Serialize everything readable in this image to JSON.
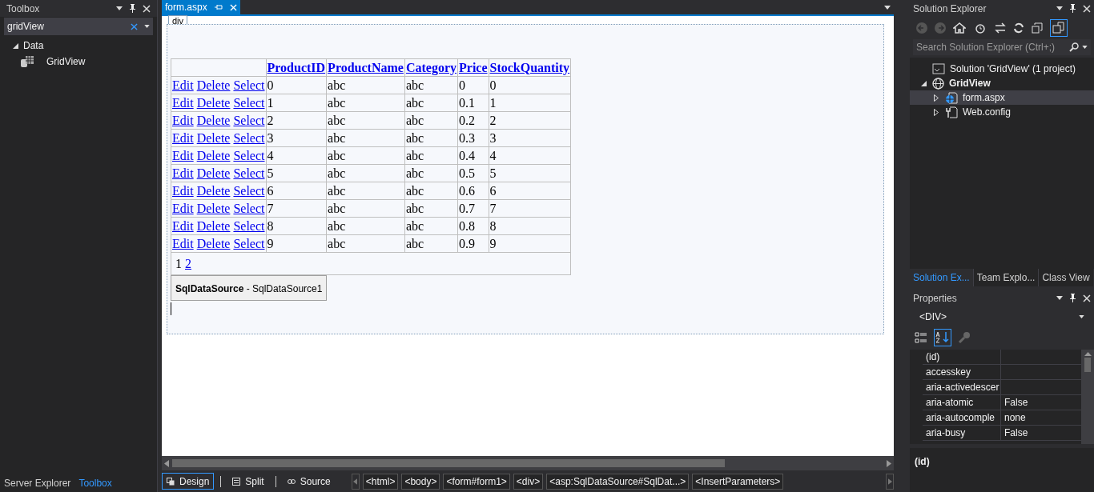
{
  "toolbox": {
    "title": "Toolbox",
    "search": "gridView",
    "groups": [
      {
        "label": "Data",
        "expanded": true,
        "children": [
          {
            "label": "GridView"
          }
        ]
      }
    ],
    "bottom_tabs": [
      {
        "label": "Server Explorer",
        "selected": false
      },
      {
        "label": "Toolbox",
        "selected": true
      }
    ]
  },
  "editor": {
    "tab": "form.aspx",
    "tag_label": "div",
    "grid": {
      "columns": [
        "ProductID",
        "ProductName",
        "Category",
        "Price",
        "StockQuantity"
      ],
      "rows": [
        {
          "actions": [
            "Edit",
            "Delete",
            "Select"
          ],
          "cells": [
            "0",
            "abc",
            "abc",
            "0",
            "0"
          ]
        },
        {
          "actions": [
            "Edit",
            "Delete",
            "Select"
          ],
          "cells": [
            "1",
            "abc",
            "abc",
            "0.1",
            "1"
          ]
        },
        {
          "actions": [
            "Edit",
            "Delete",
            "Select"
          ],
          "cells": [
            "2",
            "abc",
            "abc",
            "0.2",
            "2"
          ]
        },
        {
          "actions": [
            "Edit",
            "Delete",
            "Select"
          ],
          "cells": [
            "3",
            "abc",
            "abc",
            "0.3",
            "3"
          ]
        },
        {
          "actions": [
            "Edit",
            "Delete",
            "Select"
          ],
          "cells": [
            "4",
            "abc",
            "abc",
            "0.4",
            "4"
          ]
        },
        {
          "actions": [
            "Edit",
            "Delete",
            "Select"
          ],
          "cells": [
            "5",
            "abc",
            "abc",
            "0.5",
            "5"
          ]
        },
        {
          "actions": [
            "Edit",
            "Delete",
            "Select"
          ],
          "cells": [
            "6",
            "abc",
            "abc",
            "0.6",
            "6"
          ]
        },
        {
          "actions": [
            "Edit",
            "Delete",
            "Select"
          ],
          "cells": [
            "7",
            "abc",
            "abc",
            "0.7",
            "7"
          ]
        },
        {
          "actions": [
            "Edit",
            "Delete",
            "Select"
          ],
          "cells": [
            "8",
            "abc",
            "abc",
            "0.8",
            "8"
          ]
        },
        {
          "actions": [
            "Edit",
            "Delete",
            "Select"
          ],
          "cells": [
            "9",
            "abc",
            "abc",
            "0.9",
            "9"
          ]
        }
      ],
      "pager": [
        {
          "label": "1",
          "current": true
        },
        {
          "label": "2",
          "current": false
        }
      ]
    },
    "datasource": "**SqlDataSource** - SqlDataSource1",
    "view_tabs": [
      {
        "label": "Design",
        "selected": true
      },
      {
        "label": "Split",
        "selected": false
      },
      {
        "label": "Source",
        "selected": false
      }
    ],
    "breadcrumbs": [
      "<html>",
      "<body>",
      "<form#form1>",
      "<div>",
      "<asp:SqlDataSource#SqlDat...>",
      "<InsertParameters>"
    ]
  },
  "solution_explorer": {
    "title": "Solution Explorer",
    "search_placeholder": "Search Solution Explorer (Ctrl+;)",
    "tree": [
      {
        "label": "Solution 'GridView' (1 project)",
        "kind": "solution",
        "selected": false,
        "children": [
          {
            "label": "GridView",
            "kind": "project",
            "selected": false,
            "expanded": true,
            "children": [
              {
                "label": "form.aspx",
                "kind": "page",
                "selected": true,
                "expanded": false
              },
              {
                "label": "Web.config",
                "kind": "config",
                "selected": false,
                "expanded": false
              }
            ]
          }
        ]
      }
    ],
    "bottom_tabs": [
      {
        "label": "Solution Ex...",
        "selected": true
      },
      {
        "label": "Team Explo...",
        "selected": false
      },
      {
        "label": "Class View",
        "selected": false
      }
    ]
  },
  "properties": {
    "title": "Properties",
    "object": "<DIV>",
    "rows": [
      {
        "name": "(id)",
        "value": ""
      },
      {
        "name": "accesskey",
        "value": ""
      },
      {
        "name": "aria-activedescer",
        "value": ""
      },
      {
        "name": "aria-atomic",
        "value": "False"
      },
      {
        "name": "aria-autocomple",
        "value": "none"
      },
      {
        "name": "aria-busy",
        "value": "False"
      }
    ],
    "description": "(id)"
  }
}
